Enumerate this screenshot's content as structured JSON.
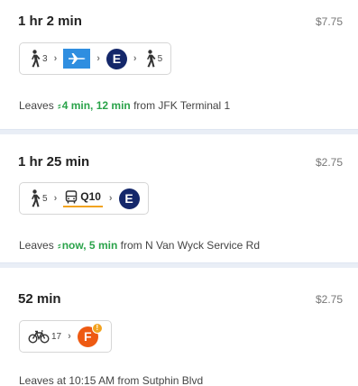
{
  "routes": [
    {
      "duration": "1 hr 2 min",
      "price": "$7.75",
      "walk1": "3",
      "badge": "E",
      "walk2": "5",
      "leaves_prefix": "Leaves",
      "leaves_times": "4 min, 12 min",
      "leaves_suffix": "from JFK Terminal 1"
    },
    {
      "duration": "1 hr 25 min",
      "price": "$2.75",
      "walk1": "5",
      "bus_label": "Q10",
      "badge": "E",
      "leaves_prefix": "Leaves",
      "leaves_times": "now, 5 min",
      "leaves_suffix": "from N Van Wyck Service Rd"
    },
    {
      "duration": "52 min",
      "price": "$2.75",
      "bike": "17",
      "badge": "F",
      "alert": "!",
      "leaves_text": "Leaves at 10:15 AM from Sutphin Blvd"
    }
  ],
  "chevron": "›",
  "realtime_icon": "⸗",
  "colors": {
    "e_train": "#14276a",
    "f_train": "#ee5a12",
    "airtrain": "#2f8ee0",
    "bus_line": "#f2a320",
    "realtime": "#2aa34a"
  }
}
